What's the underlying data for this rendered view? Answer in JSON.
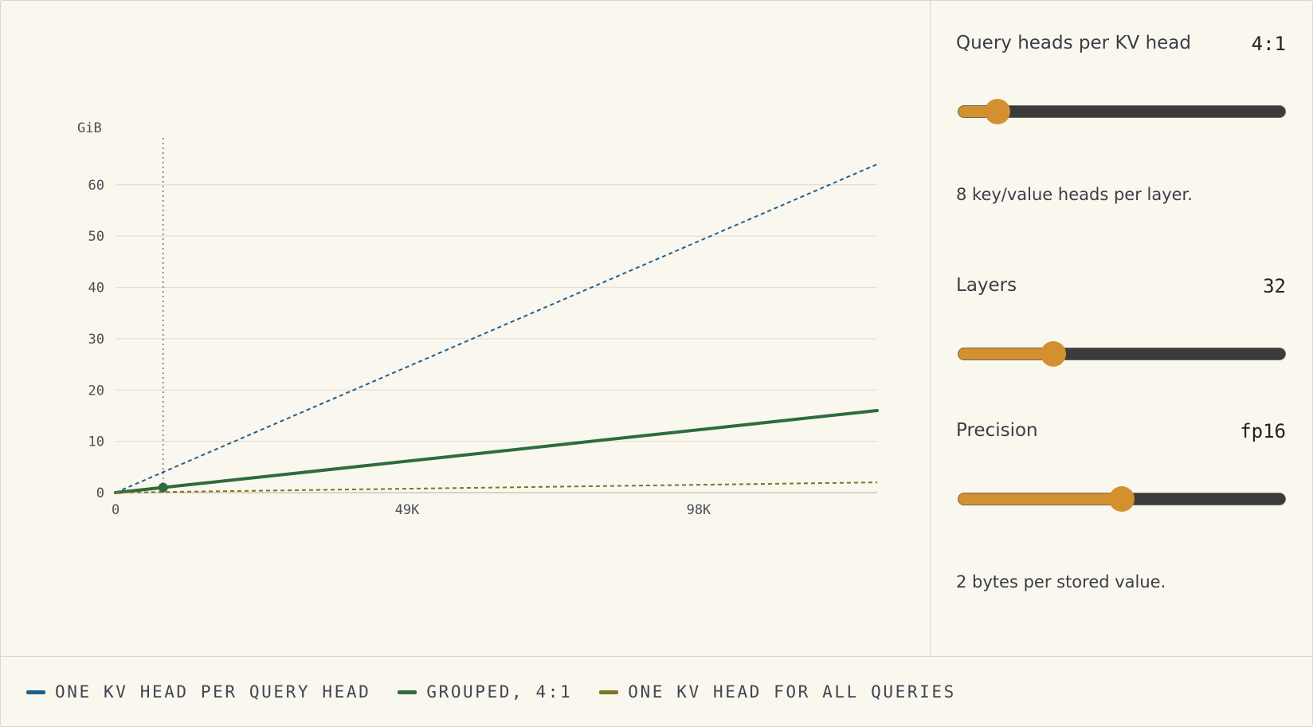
{
  "controls": {
    "ratio": {
      "label": "Query heads per KV head",
      "value": "4:1",
      "note": "8 key/value heads per layer.",
      "level": 0.12
    },
    "layers": {
      "label": "Layers",
      "value": "32",
      "level": 0.29
    },
    "precision": {
      "label": "Precision",
      "value": "fp16",
      "note": "2 bytes per stored value.",
      "level": 0.5
    }
  },
  "chart_data": {
    "type": "line",
    "xlabel": "",
    "ylabel": "GiB",
    "xlim": [
      0,
      128000
    ],
    "ylim": [
      0,
      64
    ],
    "x_ticks": [
      {
        "value": 0,
        "label": "0"
      },
      {
        "value": 49000,
        "label": "49K"
      },
      {
        "value": 98000,
        "label": "98K"
      }
    ],
    "y_ticks": [
      0,
      10,
      20,
      30,
      40,
      50,
      60
    ],
    "grid": true,
    "legend_position": "bottom",
    "marker": {
      "x": 8000,
      "y": 1
    },
    "series": [
      {
        "name": "ONE KV HEAD PER QUERY HEAD",
        "color": "#1f5f8b",
        "style": "dashed",
        "x": [
          0,
          128000
        ],
        "y": [
          0,
          64
        ]
      },
      {
        "name": "GROUPED, 4:1",
        "color": "#2e6b3e",
        "style": "solid",
        "x": [
          0,
          128000
        ],
        "y": [
          0,
          16
        ]
      },
      {
        "name": "ONE KV HEAD FOR ALL QUERIES",
        "color": "#7d7420",
        "style": "dashed",
        "x": [
          0,
          128000
        ],
        "y": [
          0,
          2
        ]
      }
    ]
  }
}
